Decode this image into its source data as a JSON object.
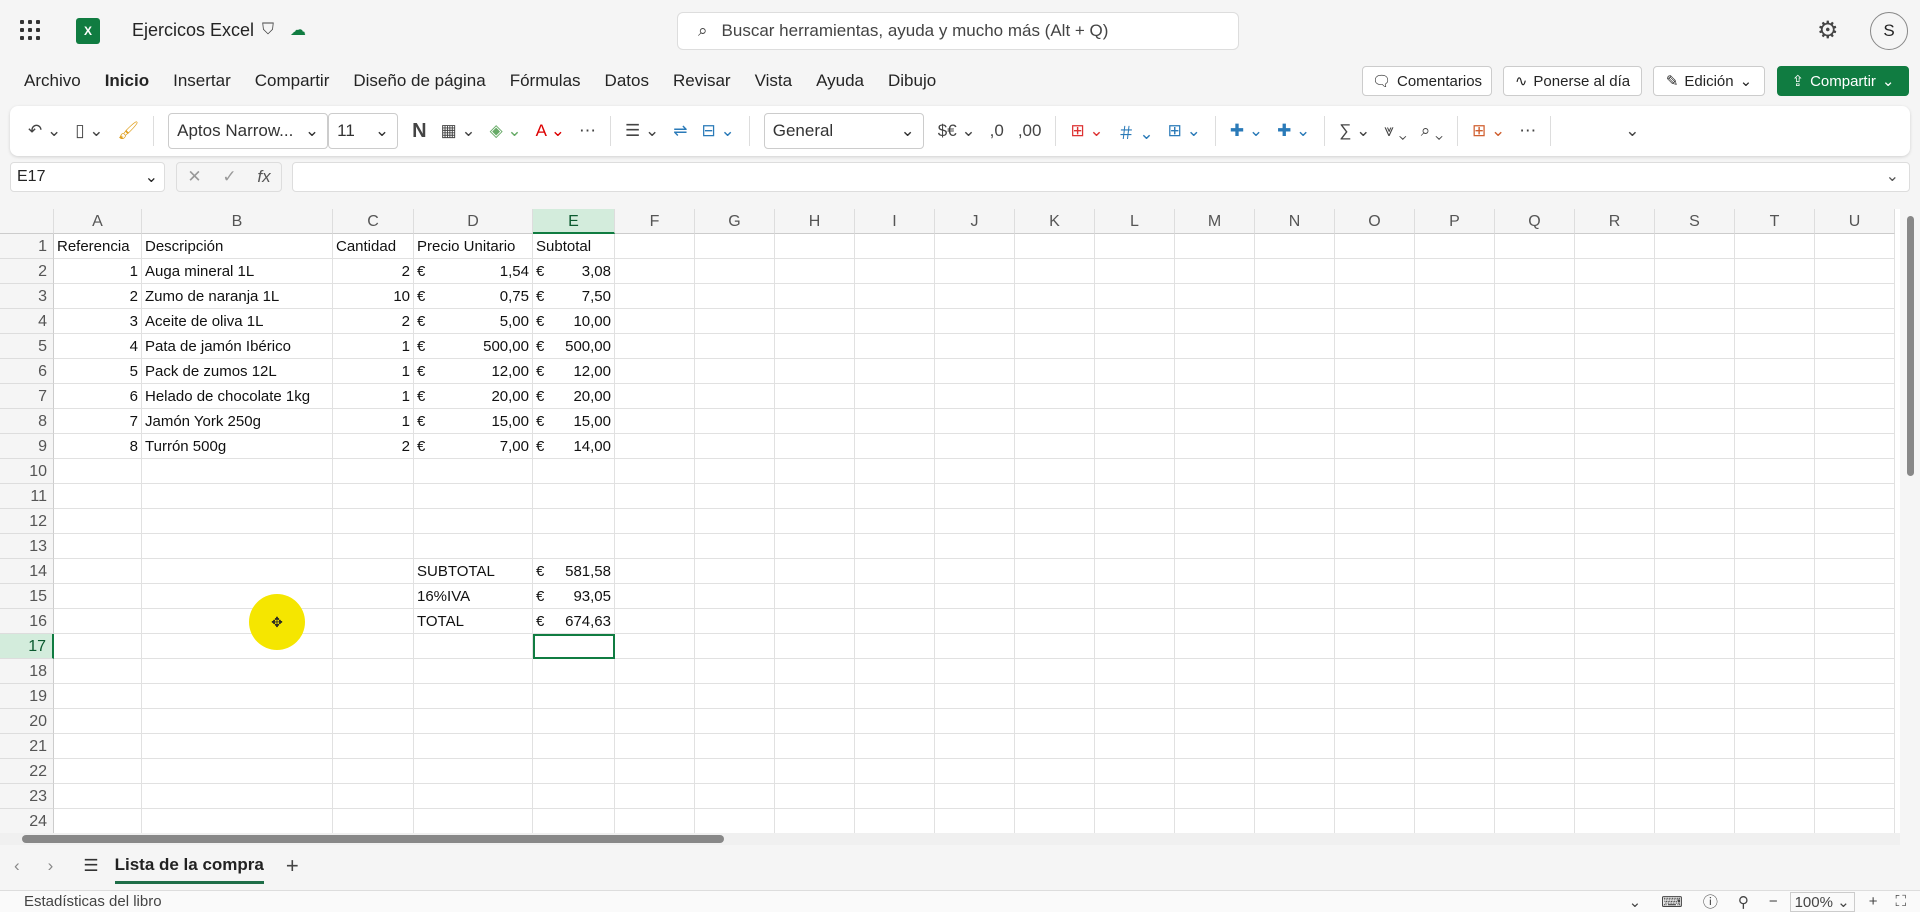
{
  "app": {
    "title": "Ejercicos Excel",
    "search_placeholder": "Buscar herramientas, ayuda y mucho más (Alt + Q)",
    "avatar": "S"
  },
  "menu": {
    "tabs": [
      "Archivo",
      "Inicio",
      "Insertar",
      "Compartir",
      "Diseño de página",
      "Fórmulas",
      "Datos",
      "Revisar",
      "Vista",
      "Ayuda",
      "Dibujo"
    ],
    "active": "Inicio",
    "comments": "Comentarios",
    "catchup": "Ponerse al día",
    "editing": "Edición",
    "share": "Compartir"
  },
  "ribbon": {
    "font": "Aptos Narrow...",
    "size": "11",
    "bold": "N",
    "number_format": "General",
    "currency": "$€",
    "fx": "fx",
    "sum": "∑"
  },
  "formula_bar": {
    "name_box": "E17",
    "value": ""
  },
  "grid": {
    "columns": [
      "A",
      "B",
      "C",
      "D",
      "E",
      "F",
      "G",
      "H",
      "I",
      "J",
      "K",
      "L",
      "M",
      "N",
      "O",
      "P",
      "Q",
      "R",
      "S",
      "T",
      "U"
    ],
    "selected_cell": "E17",
    "rows": [
      [
        "Referencia",
        "Descripción",
        "Cantidad",
        "Precio Unitario",
        "Subtotal"
      ],
      [
        "1",
        "Auga mineral 1L",
        "2",
        "€|1,54",
        "€|3,08"
      ],
      [
        "2",
        "Zumo de naranja 1L",
        "10",
        "€|0,75",
        "€|7,50"
      ],
      [
        "3",
        "Aceite de oliva 1L",
        "2",
        "€|5,00",
        "€|10,00"
      ],
      [
        "4",
        "Pata de jamón Ibérico",
        "1",
        "€|500,00",
        "€|500,00"
      ],
      [
        "5",
        "Pack de zumos 12L",
        "1",
        "€|12,00",
        "€|12,00"
      ],
      [
        "6",
        "Helado de chocolate 1kg",
        "1",
        "€|20,00",
        "€|20,00"
      ],
      [
        "7",
        "Jamón York 250g",
        "1",
        "€|15,00",
        "€|15,00"
      ],
      [
        "8",
        "Turrón 500g",
        "2",
        "€|7,00",
        "€|14,00"
      ],
      [],
      [],
      [],
      [],
      [
        "",
        "",
        "",
        "SUBTOTAL",
        "€|581,58"
      ],
      [
        "",
        "",
        "",
        "16%IVA",
        "€|93,05"
      ],
      [
        "",
        "",
        "",
        "TOTAL",
        "€|674,63"
      ],
      [],
      [],
      [],
      [],
      [],
      [],
      [],
      []
    ]
  },
  "sheets": {
    "active": "Lista de la compra"
  },
  "status": {
    "left": "Estadísticas del libro",
    "zoom": "100%"
  }
}
